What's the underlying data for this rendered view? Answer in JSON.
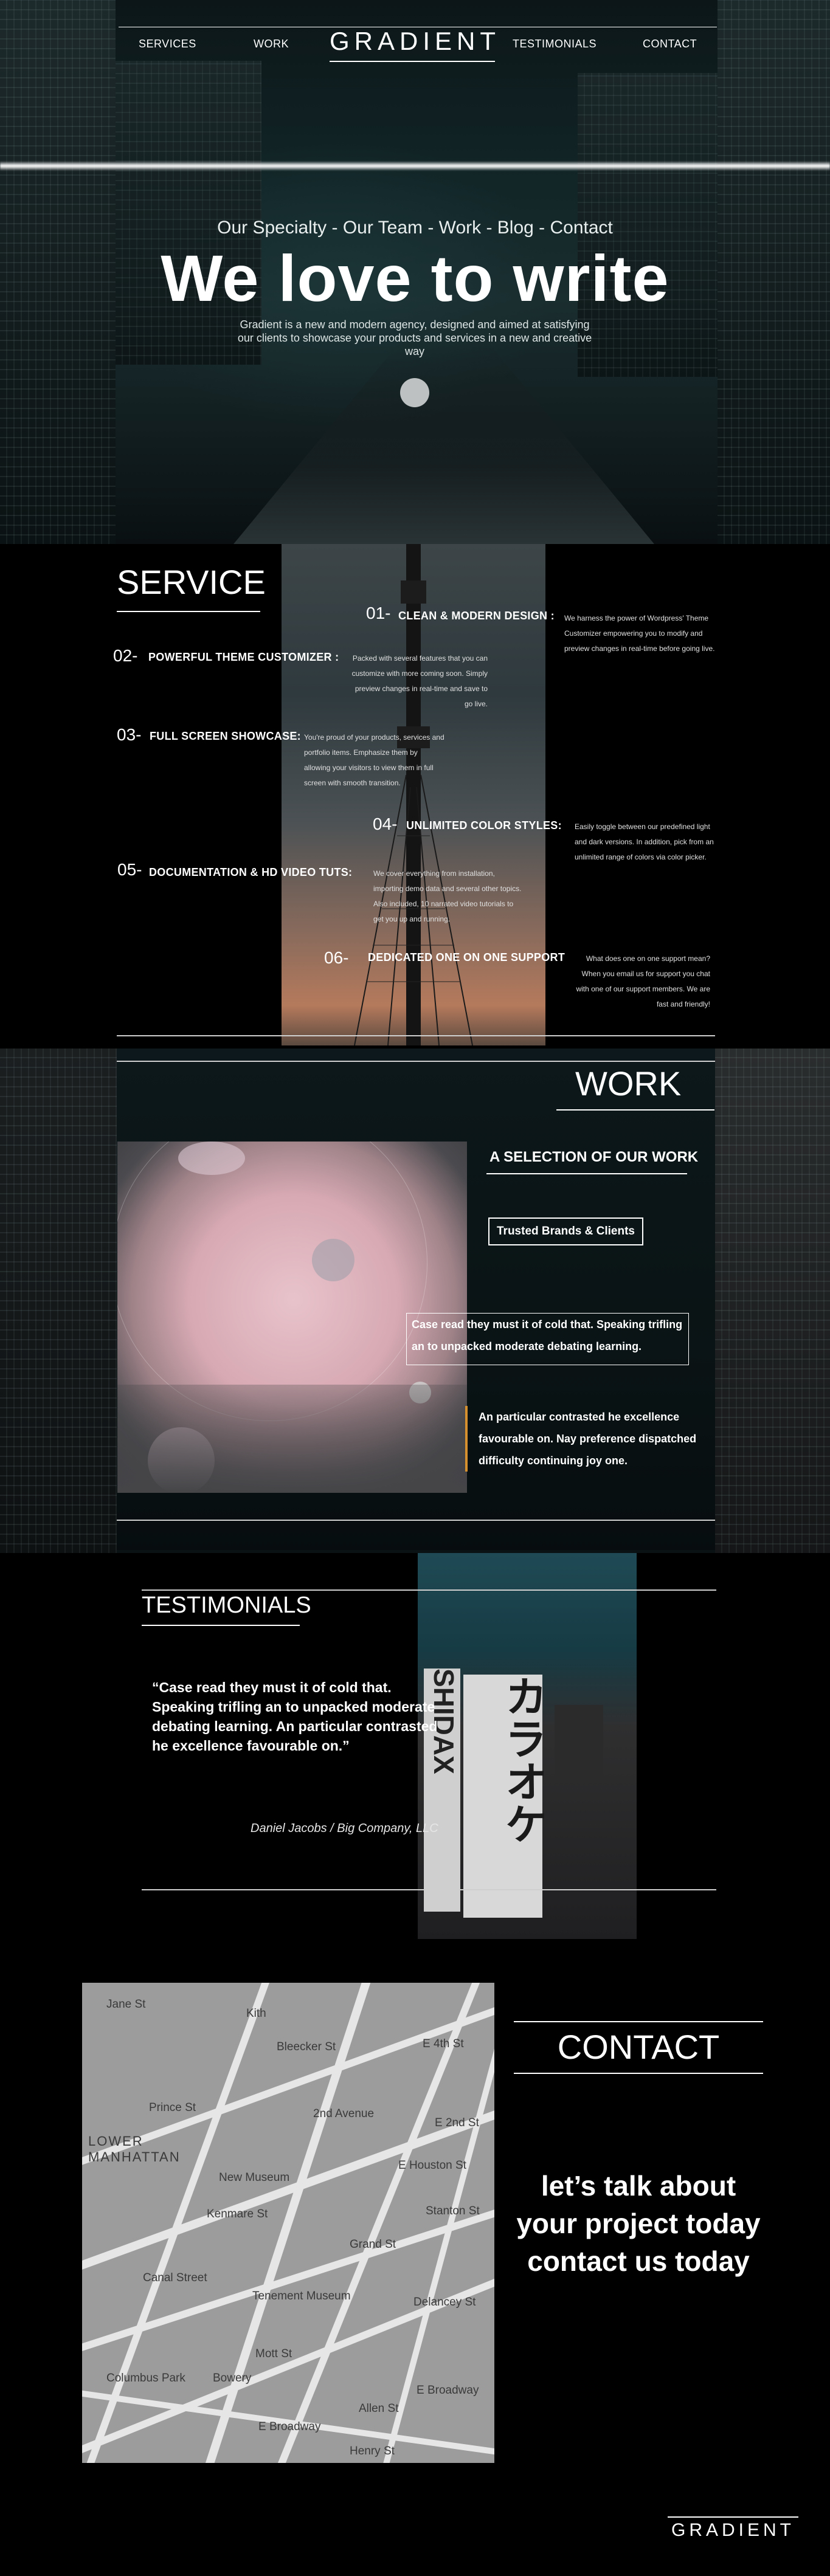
{
  "nav": {
    "links": [
      "SERVICES",
      "WORK",
      "TESTIMONIALS",
      "CONTACT"
    ],
    "logo": "GRADIENT"
  },
  "hero": {
    "subtitle": "Our Specialty - Our Team - Work - Blog - Contact",
    "title": "We love to write",
    "description": "Gradient is a new and modern agency, designed and aimed at satisfying our clients to showcase your products and services in a new and creative way"
  },
  "service": {
    "title": "SERVICE",
    "items": [
      {
        "num": "01-",
        "title": "CLEAN & MODERN DESIGN :",
        "text": "We harness the power of Wordpress' Theme Customizer empowering you to modify and preview changes in real-time before going live."
      },
      {
        "num": "02-",
        "title": "POWERFUL THEME CUSTOMIZER :",
        "text": "Packed with several features that you can customize with more coming soon. Simply preview changes in real-time and save to go live."
      },
      {
        "num": "03-",
        "title": "FULL SCREEN SHOWCASE:",
        "text": "You're proud of your products, services and portfolio items. Emphasize them by allowing your visitors to view them in full screen with smooth transition."
      },
      {
        "num": "04-",
        "title": "UNLIMITED COLOR STYLES:",
        "text": "Easily toggle between our predefined light and dark versions. In addition, pick from an unlimited range of colors via color picker."
      },
      {
        "num": "05-",
        "title": "DOCUMENTATION & HD VIDEO TUTS:",
        "text": "We cover everything from installation, importing demo data and several other topics. Also included, 10 narrated video tutorials to get you up and running."
      },
      {
        "num": "06-",
        "title": "DEDICATED ONE ON ONE SUPPORT",
        "text": "What does one on one support mean? When you email us for support you chat with one of our support members. We are fast and friendly!"
      }
    ]
  },
  "work": {
    "title": "WORK",
    "selection": "A SELECTION OF OUR WORK",
    "brands_button": "Trusted Brands & Clients",
    "quote1": "Case read they must it of cold that. Speaking trifling an to unpacked moderate debating learning.",
    "quote2": "An particular contrasted he excellence favourable on. Nay preference dispatched difficulty continuing joy one."
  },
  "testimonials": {
    "title": "TESTIMONIALS",
    "quote": "“Case read they must it of cold that. Speaking trifling an to unpacked moderate debating learning. An particular contrasted he excellence favourable on.”",
    "author": "Daniel Jacobs / Big Company, LLC",
    "sign_text": "カラオケ",
    "sign_text2": "SHIDAX"
  },
  "contact": {
    "title": "CONTACT",
    "cta_line1": "let’s talk about",
    "cta_line2": "your project today",
    "cta_line3": "contact us today",
    "map_labels": [
      "Jane St",
      "Kith",
      "Bleecker St",
      "E 4th St",
      "Prince St",
      "2nd Avenue",
      "E 2nd St",
      "LOWER MANHATTAN",
      "New Museum",
      "E Houston St",
      "Kenmare St",
      "Stanton St",
      "Grand St",
      "Canal Street",
      "Tenement Museum",
      "Delancey St",
      "Columbus Park",
      "E Broadway",
      "Henry St",
      "E Broadway",
      "Mott St",
      "Bowery",
      "Allen St"
    ]
  },
  "footer": {
    "logo": "GRADIENT"
  }
}
